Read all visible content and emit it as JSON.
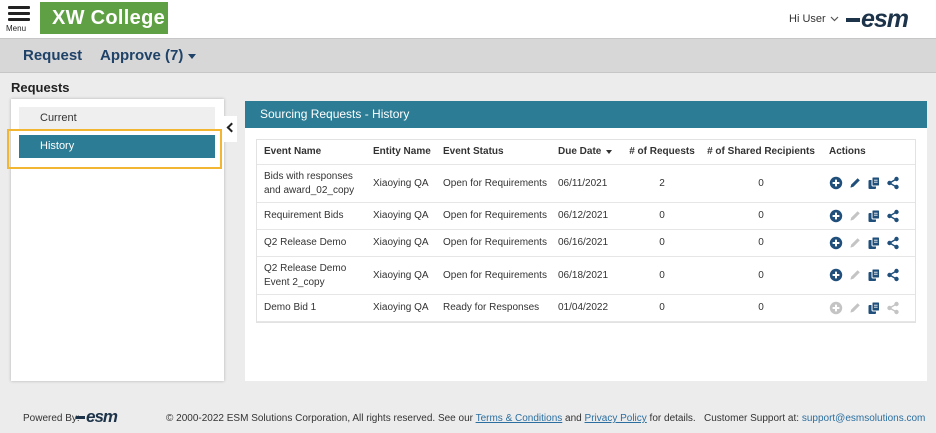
{
  "header": {
    "menu_label": "Menu",
    "logo_text": "XW College",
    "user_greeting": "Hi User",
    "brand": "esm"
  },
  "nav": {
    "request": "Request",
    "approve": "Approve (7)"
  },
  "page": {
    "title": "Requests"
  },
  "sidebar": {
    "items": [
      {
        "label": "Current",
        "active": false
      },
      {
        "label": "History",
        "active": true
      }
    ]
  },
  "panel": {
    "title": "Sourcing Requests - History",
    "columns": [
      "Event Name",
      "Entity Name",
      "Event Status",
      "Due Date",
      "# of Requests",
      "# of Shared Recipients",
      "Actions"
    ],
    "rows": [
      {
        "event_name_1": "Bids with responses",
        "event_name_2": "and award_02_copy",
        "entity": "Xiaoying QA",
        "status": "Open for Requirements",
        "due": "06/11/2021",
        "requests": "2",
        "shared": "0",
        "edit_enabled": true,
        "share_enabled": true,
        "add_enabled": true
      },
      {
        "event_name_1": "Requirement Bids",
        "event_name_2": "",
        "entity": "Xiaoying QA",
        "status": "Open for Requirements",
        "due": "06/12/2021",
        "requests": "0",
        "shared": "0",
        "edit_enabled": false,
        "share_enabled": true,
        "add_enabled": true
      },
      {
        "event_name_1": "Q2 Release Demo",
        "event_name_2": "",
        "entity": "Xiaoying QA",
        "status": "Open for Requirements",
        "due": "06/16/2021",
        "requests": "0",
        "shared": "0",
        "edit_enabled": false,
        "share_enabled": true,
        "add_enabled": true
      },
      {
        "event_name_1": "Q2 Release Demo",
        "event_name_2": "Event 2_copy",
        "entity": "Xiaoying QA",
        "status": "Open for Requirements",
        "due": "06/18/2021",
        "requests": "0",
        "shared": "0",
        "edit_enabled": false,
        "share_enabled": true,
        "add_enabled": true
      },
      {
        "event_name_1": "Demo Bid 1",
        "event_name_2": "",
        "entity": "Xiaoying QA",
        "status": "Ready for Responses",
        "due": "01/04/2022",
        "requests": "0",
        "shared": "0",
        "edit_enabled": false,
        "share_enabled": false,
        "add_enabled": false
      }
    ]
  },
  "footer": {
    "powered_by": "Powered By:",
    "brand": "esm",
    "copyright_pre": "© 2000-2022 ESM Solutions Corporation, All rights reserved. See our ",
    "terms": "Terms & Conditions",
    "and": " and ",
    "privacy": "Privacy Policy",
    "copyright_post": " for details.",
    "support_label": "Customer Support at: ",
    "support_email": "support@esmsolutions.com"
  },
  "colors": {
    "accent": "#2b7c94",
    "nav_text": "#1f4268",
    "logo_green": "#5fa044",
    "highlight": "#f2b632",
    "icon_blue": "#1f4f7a",
    "icon_disabled": "#c4c4c4"
  },
  "icons": [
    "menu-icon",
    "chevron-down-icon",
    "chevron-left-icon",
    "add-circle-icon",
    "pencil-icon",
    "copy-icon",
    "share-icon",
    "sort-down-icon"
  ]
}
